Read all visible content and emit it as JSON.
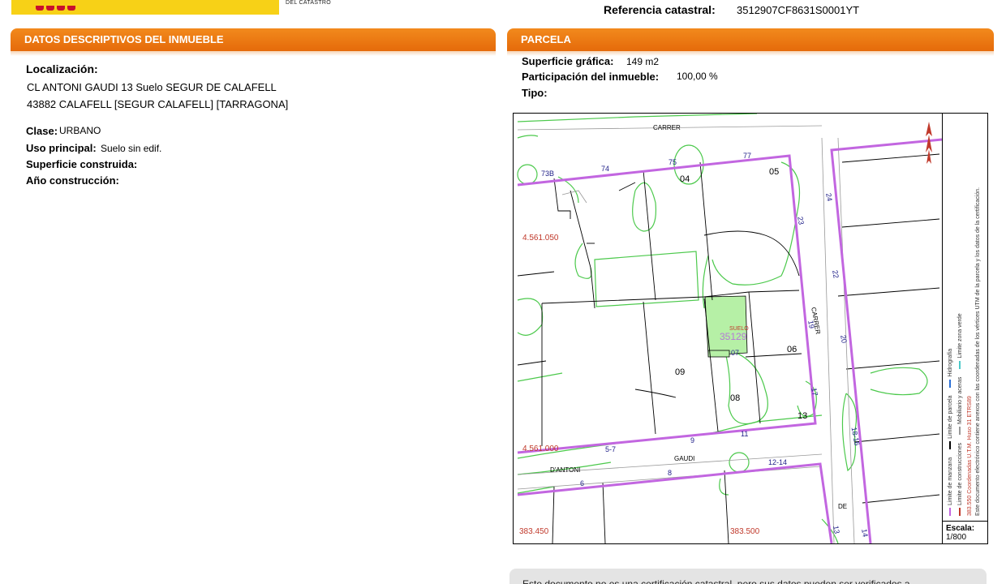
{
  "header": {
    "org_subtitle": "DEL CATASTRO",
    "ref_label": "Referencia catastral:",
    "ref_value": "3512907CF8631S0001YT"
  },
  "left_section": {
    "title_prefix": "DATOS DESCRIPTIVOS DEL ",
    "title_bold": "INMUEBLE",
    "localizacion_label": "Localización:",
    "address_line1": "CL ANTONI GAUDI 13 Suelo SEGUR DE CALAFELL",
    "address_line2": "43882 CALAFELL [SEGUR CALAFELL] [TARRAGONA]",
    "clase_label": "Clase:",
    "clase_value": "URBANO",
    "uso_label": "Uso principal:",
    "uso_value": "Suelo sin edif.",
    "superficie_label": "Superficie construida:",
    "superficie_value": "",
    "anio_label": "Año construcción:",
    "anio_value": ""
  },
  "right_section": {
    "title": "PARCELA",
    "superficie_grafica_label": "Superficie gráfica:",
    "superficie_grafica_value": "149 m2",
    "participacion_label": "Participación del inmueble:",
    "participacion_value": "100,00 %",
    "tipo_label": "Tipo:",
    "tipo_value": ""
  },
  "map": {
    "street_carrer_top": "CARRER",
    "street_carrer_right": "CARRER",
    "street_dantoni": "D'ANTONI",
    "street_gaudi": "GAUDI",
    "street_de": "DE",
    "coord_y_top": "4.561.050",
    "coord_y_bottom": "4.561.000",
    "coord_x_left": "383.450",
    "coord_x_right": "383.500",
    "parcel_label": "SUELO",
    "parcel_id": "35129",
    "parcel_small": "07",
    "parcel_numbers": [
      "04",
      "05",
      "06",
      "09",
      "08",
      "13"
    ],
    "house_numbers": [
      "73B",
      "74",
      "75",
      "77",
      "23",
      "24",
      "22",
      "19",
      "20",
      "17",
      "18-16",
      "13",
      "11",
      "9",
      "5-7",
      "12-14",
      "8",
      "6",
      "14"
    ],
    "legend": {
      "limite_manzana": "Limite de manzana",
      "limite_parcela": "Limite de parcela",
      "hidrografia": "Hidrografía",
      "limite_construcciones": "Limite de construcciones",
      "mobiliario": "Mobiliario y aceras",
      "zona_verde": "Limite zona verde",
      "coords_note": "383.550 Coordenadas U.T.M. Huso 31 ETRS89",
      "electronic_note": "Este documento electrónico contiene anexos con las coordenadas de los vértices UTM de la parcela y los datos de la certificación."
    },
    "scale_label": "Escala:",
    "scale_value": "1/800"
  },
  "footer_note": "Este documento no es una certificación catastral, pero sus datos pueden ser verificados a",
  "colors": {
    "header_orange": "#e8720e",
    "block_limit": "#c266e0",
    "green_limit": "#4cc94c",
    "parcel_fill": "#b6f0a6",
    "coord_red": "#c0392b",
    "house_number_blue": "#22228a"
  }
}
